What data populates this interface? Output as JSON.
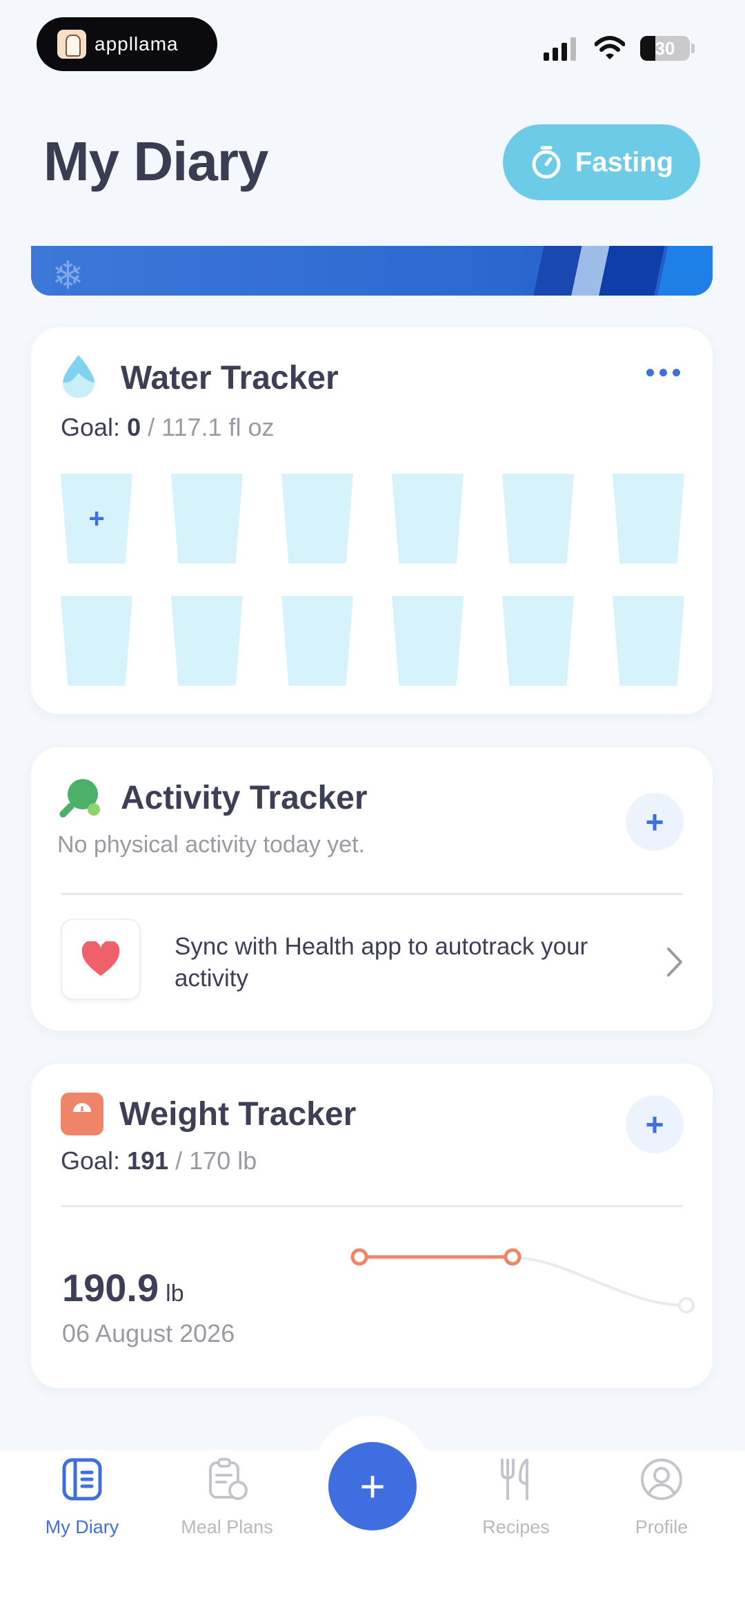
{
  "status_bar": {
    "app_pill_text": "appllama",
    "battery_level": "30"
  },
  "header": {
    "title": "My Diary",
    "fasting_label": "Fasting"
  },
  "water_tracker": {
    "title": "Water Tracker",
    "goal_label": "Goal:",
    "goal_current": "0",
    "goal_target": "/ 117.1 fl oz",
    "glasses_total": 12,
    "add_symbol": "+",
    "color": "#d6f2fb"
  },
  "activity_tracker": {
    "title": "Activity Tracker",
    "subtitle": "No physical activity today yet.",
    "add_symbol": "+",
    "sync_text": "Sync with Health app to autotrack your activity"
  },
  "weight_tracker": {
    "title": "Weight Tracker",
    "goal_label": "Goal:",
    "goal_current": "191",
    "goal_target": "/ 170 lb",
    "add_symbol": "+",
    "value": "190.9",
    "unit": "lb",
    "date": "06 August 2026",
    "accent": "#f08468"
  },
  "bottom_nav": {
    "items": [
      {
        "label": "My Diary",
        "icon": "diary-icon",
        "active": true
      },
      {
        "label": "Meal Plans",
        "icon": "meal-plans-icon",
        "active": false
      },
      {
        "label": "Recipes",
        "icon": "recipes-icon",
        "active": false
      },
      {
        "label": "Profile",
        "icon": "profile-icon",
        "active": false
      }
    ],
    "fab_symbol": "+",
    "accent": "#3f6ee0"
  }
}
